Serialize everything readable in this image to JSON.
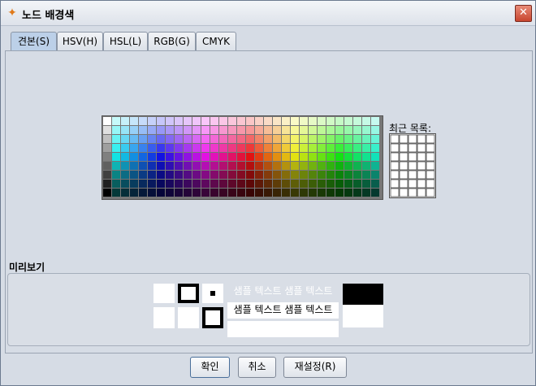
{
  "window": {
    "title": "노드 배경색",
    "app_icon": "butterfly-icon",
    "close_icon": "close-icon"
  },
  "tabs": [
    {
      "label": "견본(S)",
      "active": true
    },
    {
      "label": "HSV(H)",
      "active": false
    },
    {
      "label": "HSL(L)",
      "active": false
    },
    {
      "label": "RGB(G)",
      "active": false
    },
    {
      "label": "CMYK",
      "active": false
    }
  ],
  "swatches": {
    "recent_label": "최근 목록:"
  },
  "preview": {
    "title": "미리보기",
    "sample_text": "샘플 텍스트  샘플 텍스트",
    "sample_fg": "#ffffff"
  },
  "buttons": {
    "ok": "확인",
    "cancel": "취소",
    "reset": "재설정(R)"
  }
}
